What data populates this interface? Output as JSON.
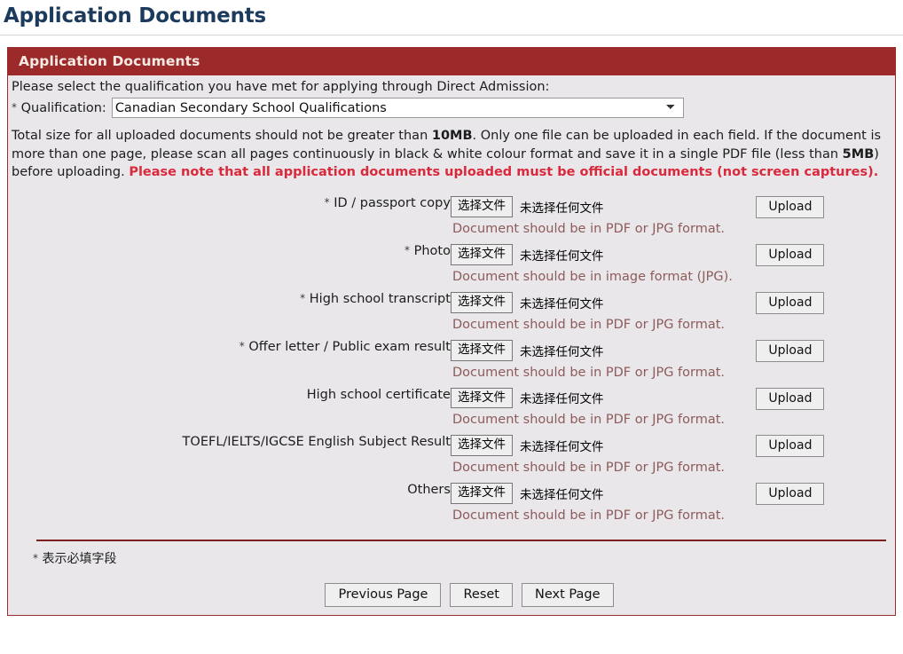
{
  "page": {
    "title": "Application Documents"
  },
  "panel": {
    "header": "Application Documents",
    "intro": "Please select the qualification you have met for applying through Direct Admission:",
    "qualification_label_star": "*",
    "qualification_label": "Qualification:",
    "qualification_value": "Canadian Secondary School Qualifications",
    "qualification_options": [
      "Canadian Secondary School Qualifications"
    ],
    "notice": {
      "part1": "Total size for all uploaded documents should not be greater than ",
      "bold1": "10MB",
      "part2": ". Only one file can be uploaded in each field. If the document is more than one page, please scan all pages continuously in black & white colour format and save it in a single PDF file (less than ",
      "bold2": "5MB",
      "part3": ") before uploading. ",
      "warning": "Please note that all application documents uploaded must be official documents (not screen captures)."
    }
  },
  "file_input": {
    "choose_button": "选择文件",
    "no_file_text": "未选择任何文件",
    "upload_button": "Upload"
  },
  "documents": [
    {
      "required": true,
      "star": "*",
      "label": "ID / passport copy",
      "hint": "Document should be in PDF or JPG format."
    },
    {
      "required": true,
      "star": "*",
      "label": "Photo",
      "hint": "Document should be in image format (JPG)."
    },
    {
      "required": true,
      "star": "*",
      "label": "High school transcript",
      "hint": "Document should be in PDF or JPG format."
    },
    {
      "required": true,
      "star": "*",
      "label": "Offer letter / Public exam result",
      "hint": "Document should be in PDF or JPG format."
    },
    {
      "required": false,
      "star": "",
      "label": "High school certificate",
      "hint": "Document should be in PDF or JPG format."
    },
    {
      "required": false,
      "star": "",
      "label": "TOEFL/IELTS/IGCSE English Subject Result",
      "hint": "Document should be in PDF or JPG format."
    },
    {
      "required": false,
      "star": "",
      "label": "Others",
      "hint": "Document should be in PDF or JPG format."
    }
  ],
  "footer": {
    "required_note_star": "*",
    "required_note": "表示必填字段",
    "buttons": {
      "previous": "Previous Page",
      "reset": "Reset",
      "next": "Next Page"
    }
  },
  "colors": {
    "title": "#1b3a5c",
    "panel_header_bg": "#9d2a2a",
    "panel_border": "#9d2c2c",
    "panel_body_bg": "#e9e7ea",
    "warning_text": "#d92a3d",
    "hint_text": "#8d5b5b",
    "footer_rule": "#7e1f1f"
  }
}
